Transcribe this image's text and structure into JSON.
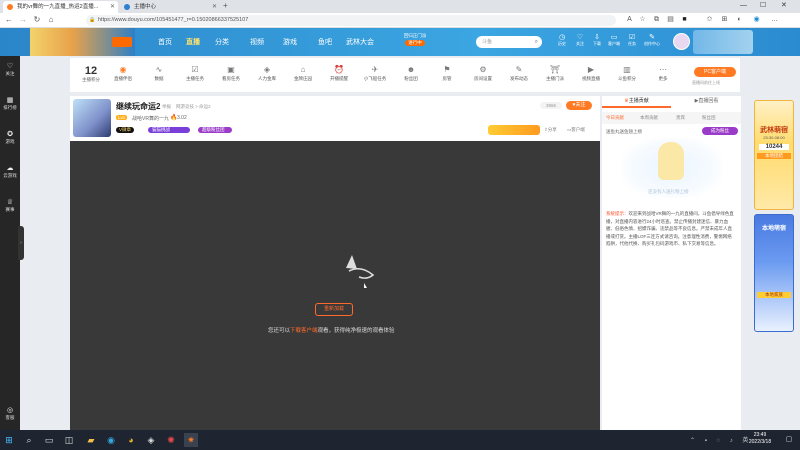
{
  "browser": {
    "tabs": [
      {
        "label": "我的vr舞的一九直播_热运2直播...",
        "active": true
      },
      {
        "label": "主播中心",
        "active": false
      }
    ],
    "url": "https://www.douyu.com/105451477_r=0.15020866337525107"
  },
  "header": {
    "nav": [
      "首页",
      "直播",
      "分类",
      "视频",
      "游戏",
      "鱼吧",
      "武林大会"
    ],
    "active_nav": "直播",
    "promo_line1": "回归正门派",
    "promo_line2": "进行中",
    "search_placeholder": "斗鱼",
    "icons": [
      "历史",
      "关注",
      "下载",
      "客户端",
      "任务",
      "创作中心"
    ]
  },
  "sidebar": {
    "items": [
      "关注",
      "排行榜",
      "游戏",
      "云游戏",
      "赛事"
    ],
    "bottom": "客服"
  },
  "toolbar": {
    "level_number": "12",
    "level_label": "主播积分",
    "items": [
      "直播伴侣",
      "数据",
      "主播任务",
      "看房任务",
      "人力金库",
      "金牌庄园",
      "开播提醒",
      "小飞船任务",
      "粉丝团",
      "房管",
      "房间设置",
      "发布动态",
      "主播门派",
      "视频直播",
      "斗鱼积分",
      "更多"
    ],
    "pc_button": "PC客户端",
    "pc_sub": "直播间前往上线"
  },
  "room": {
    "title": "继续玩命运2",
    "report": "举报",
    "category": "网游竞技 > 命运2",
    "rank_badge": "Lv1",
    "streamer": "战哈VR舞的一九",
    "hot": "3.02",
    "badge_v": "V微章",
    "tag1": "猫猫挑战",
    "tag2": "超级粉丝团",
    "follower_count": "3966",
    "follow_btn": "关注",
    "share": "分享",
    "report2": "客户端"
  },
  "video": {
    "retry_btn": "重新加载",
    "tip_pre": "您还可以",
    "tip_link": "下载客户端",
    "tip_post": "观看，获得纯净极速的观看体验"
  },
  "right": {
    "tabs_top": [
      "主播贡献",
      "直播回看"
    ],
    "tabs": [
      "今日贡献",
      "本周贡献",
      "贵宾",
      "粉丝团"
    ],
    "fan_btn": "成为粉丝",
    "hint": "送鱼丸送鱼翅上榜",
    "empty_text": "还没有人送礼物上榜",
    "notice_label": "系统提示：",
    "notice": "欢迎来到战哈VR舞的一九的直播间，斗鱼倡导绿色直播，对直播内容进行24小时巡查。禁止传播封建迷信、暴力血腥、低俗色情、招嫖诈骗、违禁品等不良信息。严禁未成年人直播或打赏。主播LOF三连方式请咨询。注意理性消费，警惕网络陷阱，代他代换、购买礼包码游戏币、私下交易等信息。"
  },
  "ads": {
    "ad1_title": "武林萌宿",
    "ad1_sub": "23:30-08:00",
    "ad1_num": "10244",
    "ad1_line": "本地团结",
    "ad2_title": "本地萌宿",
    "ad2_line": "本地家族"
  },
  "taskbar": {
    "time": "23:49",
    "date": "2022/3/18"
  }
}
